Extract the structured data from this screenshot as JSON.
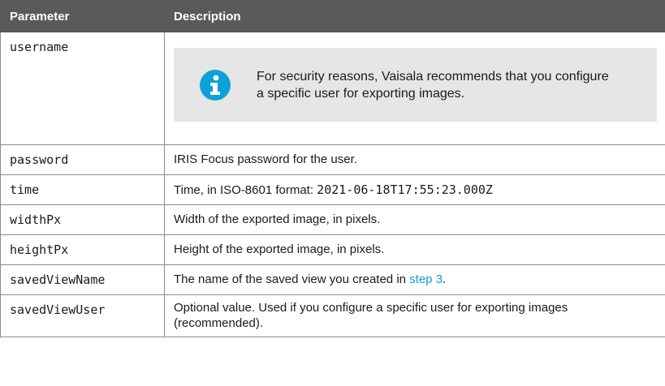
{
  "table": {
    "headers": {
      "parameter": "Parameter",
      "description": "Description"
    },
    "username": {
      "name": "username",
      "note_icon": "info-icon",
      "note_text": "For security reasons, Vaisala recommends that you configure a specific user for exporting images."
    },
    "password": {
      "name": "password",
      "description": "IRIS Focus password for the user."
    },
    "time": {
      "name": "time",
      "description_prefix": "Time, in ISO-8601 format: ",
      "example": "2021-06-18T17:55:23.000Z"
    },
    "widthPx": {
      "name": "widthPx",
      "description": "Width of the exported image, in pixels."
    },
    "heightPx": {
      "name": "heightPx",
      "description": "Height of the exported image, in pixels."
    },
    "savedViewName": {
      "name": "savedViewName",
      "description_prefix": "The name of the saved view you created in ",
      "link_text": "step 3",
      "description_suffix": "."
    },
    "savedViewUser": {
      "name": "savedViewUser",
      "description": "Optional value. Used if you configure a specific user for exporting images (recommended)."
    }
  },
  "colors": {
    "header_bg": "#5a5a5a",
    "note_bg": "#e6e6e6",
    "icon": "#0ea0d6",
    "link": "#0ea0d6"
  }
}
